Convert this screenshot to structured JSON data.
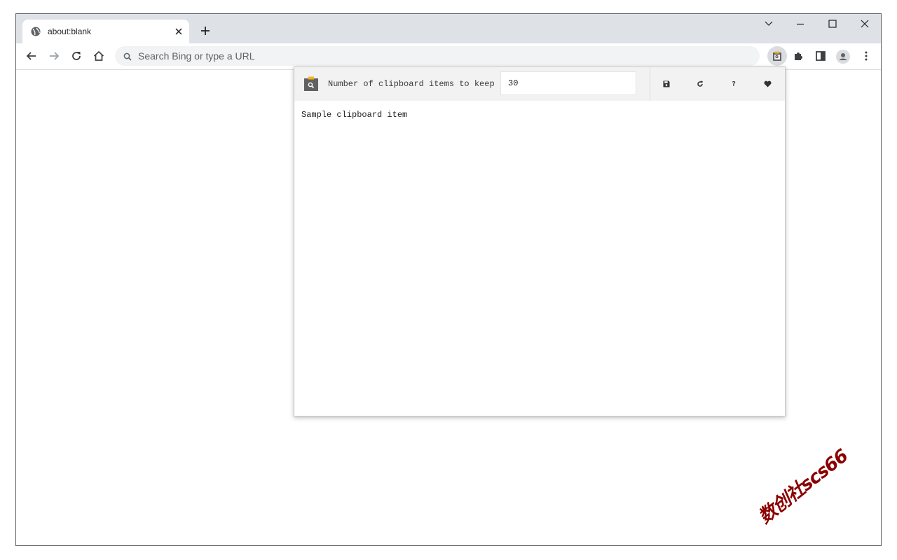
{
  "browser": {
    "tab": {
      "title": "about:blank",
      "favicon": "globe-icon",
      "close_icon": "close-icon"
    },
    "new_tab_icon": "plus-icon",
    "window_controls": [
      "chevron-down-icon",
      "minimize-icon",
      "maximize-icon",
      "close-icon"
    ],
    "nav_icons": [
      "back-arrow-icon",
      "forward-arrow-icon",
      "reload-icon",
      "home-icon"
    ],
    "omnibox": {
      "placeholder": "Search Bing or type a URL",
      "icon": "search-icon"
    },
    "toolbar_icons": [
      "clipboard-extension-icon",
      "puzzle-icon",
      "side-panel-icon",
      "profile-icon",
      "kebab-menu-icon"
    ]
  },
  "popup": {
    "setting_label": "Number of clipboard items to keep",
    "setting_value": "30",
    "buttons": [
      "save-icon",
      "refresh-icon",
      "help-icon",
      "heart-icon"
    ],
    "help_glyph": "?",
    "items": [
      "Sample clipboard item"
    ]
  },
  "watermark": "数创社scs66",
  "colors": {
    "tabstrip": "#dee1e6",
    "omnibox": "#f1f3f4",
    "popup_header": "#f2f2f2",
    "watermark": "#8b0000"
  }
}
